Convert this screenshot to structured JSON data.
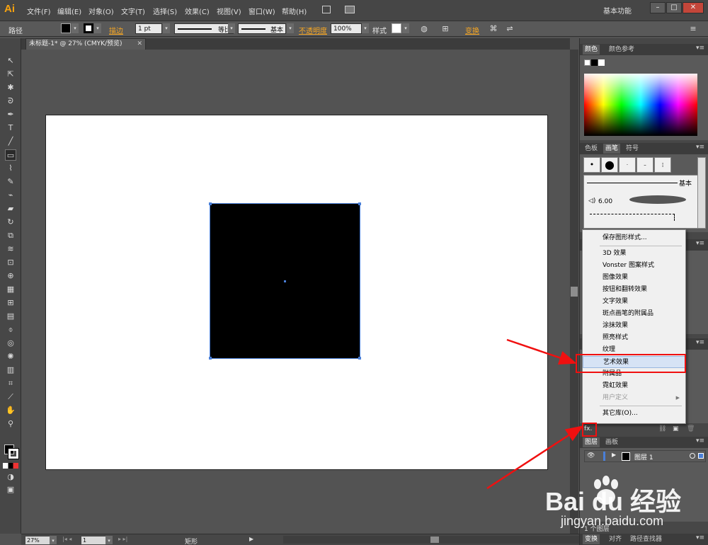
{
  "app": {
    "logo": "Ai",
    "menu": [
      "文件(F)",
      "编辑(E)",
      "对象(O)",
      "文字(T)",
      "选择(S)",
      "效果(C)",
      "视图(V)",
      "窗口(W)",
      "帮助(H)"
    ],
    "workspace": "基本功能",
    "window_buttons": [
      "–",
      "□",
      "✕"
    ]
  },
  "control_bar": {
    "selection_label": "路径",
    "stroke_label": "描边",
    "stroke_weight": "1 pt",
    "variable_width": "等比",
    "brush": "基本",
    "opacity_label": "不透明度",
    "opacity_value": "100%",
    "style_label": "样式",
    "transform_label": "变换"
  },
  "document": {
    "tab_title": "未标题-1* @ 27% (CMYK/预览)",
    "close": "✕"
  },
  "status_bar": {
    "zoom": "27%",
    "artboard_number": "1",
    "current_tool": "矩形"
  },
  "panels": {
    "color_tabs": [
      "颜色",
      "颜色参考"
    ],
    "brush_tabs": [
      "色板",
      "画笔",
      "符号"
    ],
    "brush_basic_label": "基本",
    "brush_calligraphic_size": "6.00",
    "layers_tabs": [
      "图层",
      "画板"
    ],
    "layer_name": "图层 1",
    "layers_count": "1 个图层",
    "bottom_tabs": [
      "变换",
      "对齐",
      "路径查找器"
    ],
    "graphic_styles_button": "fx."
  },
  "dropdown_menu": {
    "items": [
      {
        "label": "保存图形样式...",
        "disabled": false
      },
      {
        "separator": true
      },
      {
        "label": "3D 效果",
        "disabled": false
      },
      {
        "label": "Vonster 图案样式",
        "disabled": false
      },
      {
        "label": "图像效果",
        "disabled": false
      },
      {
        "label": "按钮和翻转效果",
        "disabled": false
      },
      {
        "label": "文字效果",
        "disabled": false
      },
      {
        "label": "斑点画笔的附属品",
        "disabled": false
      },
      {
        "label": "涂抹效果",
        "disabled": false
      },
      {
        "label": "照亮样式",
        "disabled": false
      },
      {
        "label": "纹理",
        "disabled": false
      },
      {
        "label": "艺术效果",
        "disabled": false,
        "highlighted": true
      },
      {
        "label": "附属品",
        "disabled": false
      },
      {
        "label": "霓虹效果",
        "disabled": false
      },
      {
        "label": "用户定义",
        "disabled": true,
        "submenu": true
      },
      {
        "separator": true
      },
      {
        "label": "其它库(O)...",
        "disabled": false
      }
    ]
  },
  "watermark": {
    "logo": "Bai du 经验",
    "url": "jingyan.baidu.com"
  },
  "colors": {
    "annotation": "#f01010",
    "selection": "#4a7fd7",
    "accent_link": "#f6a623"
  }
}
